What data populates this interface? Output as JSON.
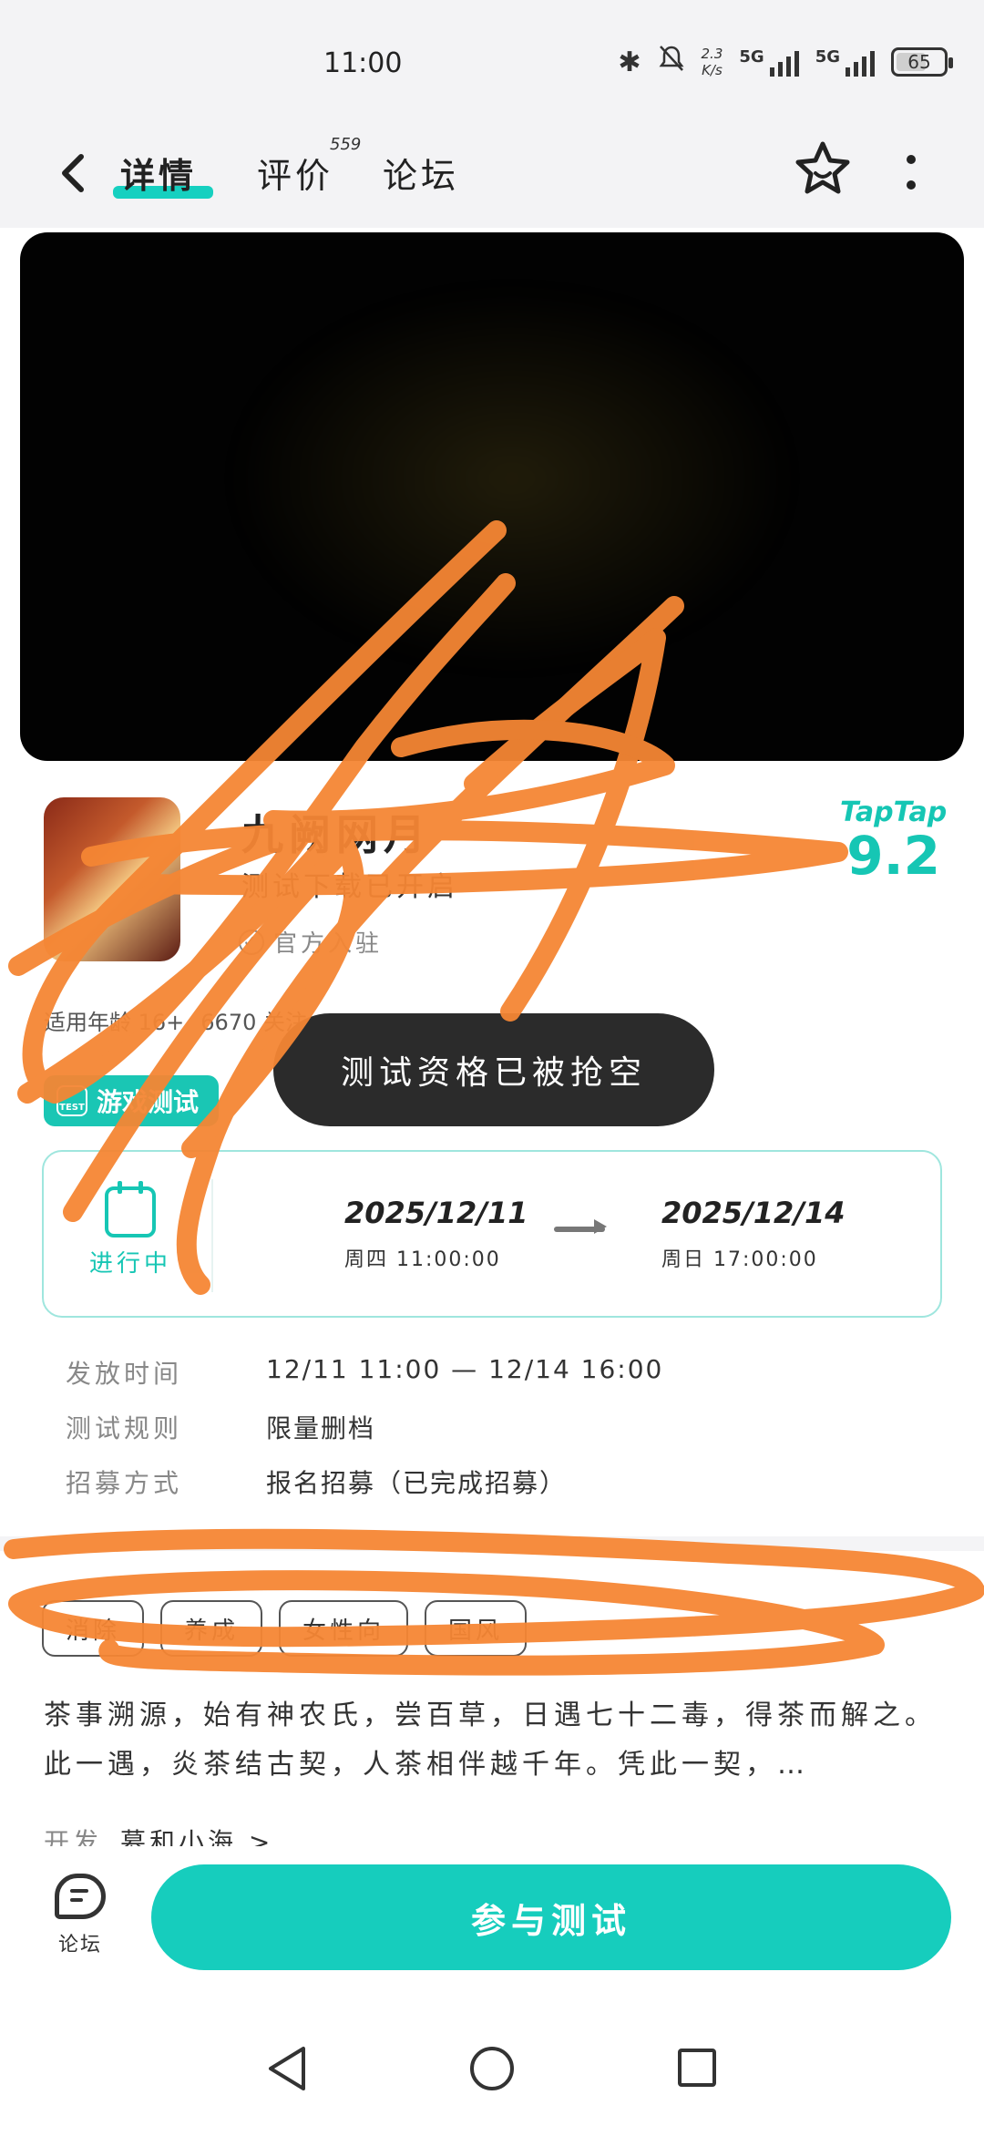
{
  "status_bar": {
    "time": "11:00",
    "net_speed_value": "2.3",
    "net_speed_unit": "K/s",
    "signal1_label": "5G",
    "signal2_label": "5G",
    "battery": "65",
    "icons": [
      "bluetooth-icon",
      "mute-bell-icon"
    ]
  },
  "header": {
    "tabs": [
      {
        "label": "详情",
        "active": true
      },
      {
        "label": "评价",
        "badge": "559"
      },
      {
        "label": "论坛"
      }
    ]
  },
  "app": {
    "name": "九阙网月",
    "subtitle": "测试下载已开启",
    "official": "官方入驻",
    "rating_brand": "TapTap",
    "rating": "9.2",
    "age_label": "适用年龄 16+",
    "followers": "6670 关注"
  },
  "badge": {
    "label": "游戏测试"
  },
  "toast": {
    "text": "测试资格已被抢空"
  },
  "schedule": {
    "status": "进行中",
    "start_date": "2025/12/11",
    "start_time": "周四  11:00:00",
    "end_date": "2025/12/14",
    "end_time": "周日  17:00:00"
  },
  "info": {
    "rows": [
      {
        "label": "发放时间",
        "value": "12/11 11:00 — 12/14 16:00"
      },
      {
        "label": "测试规则",
        "value": "限量删档"
      },
      {
        "label": "招募方式",
        "value": "报名招募（已完成招募）"
      }
    ]
  },
  "tags": [
    "消除",
    "养成",
    "女性向",
    "国风"
  ],
  "description": "茶事溯源，始有神农氏，尝百草，日遇七十二毒，得茶而解之。此一遇，炎茶结古契，人茶相伴越千年。凭此一契，…",
  "developer": {
    "label": "开发",
    "value": "慕和小海 >"
  },
  "bottom": {
    "forum_label": "论坛",
    "join_label": "参与测试"
  },
  "colors": {
    "accent": "#16cdbd",
    "toast": "#2b2b2b",
    "scribble": "#f58634"
  }
}
